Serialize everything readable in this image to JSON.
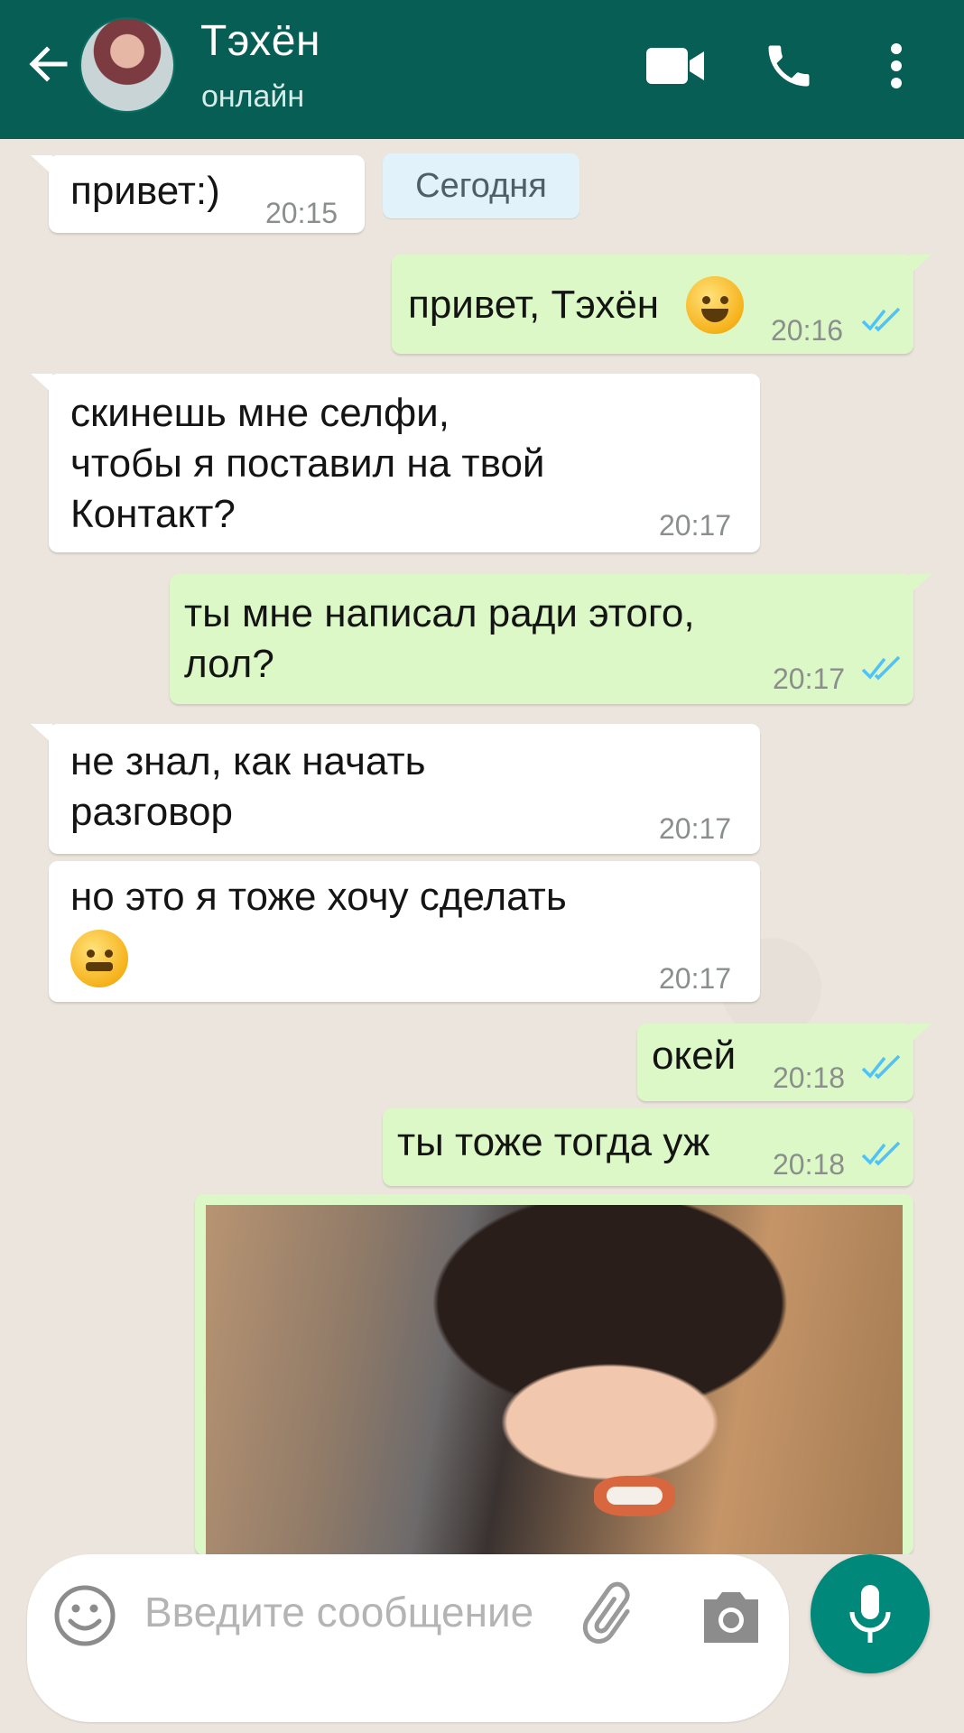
{
  "header": {
    "contact_name": "Тэхён",
    "status": "онлайн",
    "icons": [
      "back-arrow-icon",
      "video-call-icon",
      "phone-icon",
      "more-vert-icon"
    ]
  },
  "chat": {
    "date_label": "Сегодня",
    "messages": [
      {
        "direction": "in",
        "text": "привет:)",
        "time": "20:15"
      },
      {
        "direction": "out",
        "text": "привет, Тэхён",
        "emoji": "grinning-sweat",
        "time": "20:16",
        "status": "read"
      },
      {
        "direction": "in",
        "text": "скинешь мне селфи,\nчтобы я поставил на твой\nКонтакт?",
        "time": "20:17"
      },
      {
        "direction": "out",
        "text": "ты мне написал ради этого,\nлол?",
        "time": "20:17",
        "status": "read"
      },
      {
        "direction": "in",
        "text": "не знал, как начать\nразговор",
        "time": "20:17"
      },
      {
        "direction": "in",
        "text": "но это я тоже хочу сделать",
        "emoji": "face-with-steam",
        "time": "20:17"
      },
      {
        "direction": "out",
        "text": "окей",
        "time": "20:18",
        "status": "read"
      },
      {
        "direction": "out",
        "text": "ты тоже тогда уж",
        "time": "20:18",
        "status": "read"
      },
      {
        "direction": "out",
        "type": "image",
        "description": "photo"
      }
    ]
  },
  "input": {
    "placeholder": "Введите сообщение"
  },
  "colors": {
    "header_bg": "#075e54",
    "chat_bg": "#ece5dd",
    "outgoing_bubble": "#dcf8c6",
    "incoming_bubble": "#ffffff",
    "read_ticks": "#4fc3f7",
    "mic_button": "#00897b"
  }
}
